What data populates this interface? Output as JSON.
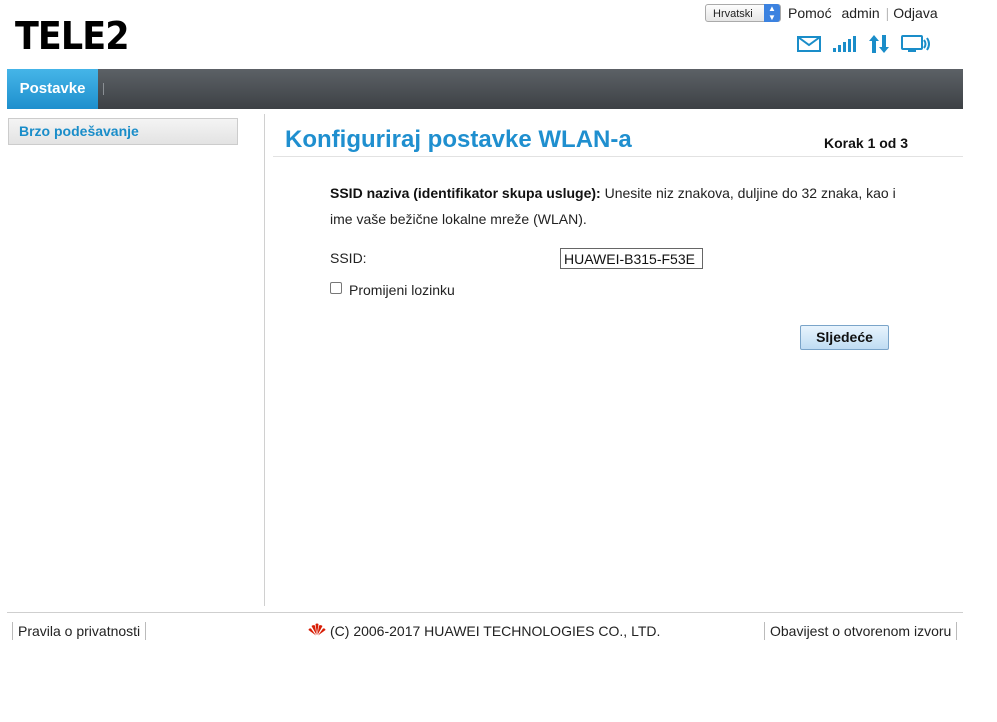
{
  "header": {
    "logo_text": "TELE2",
    "language": "Hrvatski",
    "help": "Pomoć",
    "user": "admin",
    "logout": "Odjava",
    "icons": [
      "mail-icon",
      "signal-icon",
      "data-transfer-icon",
      "monitor-icon"
    ],
    "icon_color": "#1a8dc9"
  },
  "nav": {
    "active_tab": "Postavke"
  },
  "sidebar": {
    "items": [
      {
        "label": "Brzo podešavanje"
      }
    ]
  },
  "main": {
    "title": "Konfiguriraj postavke WLAN-a",
    "step": "Korak 1 od 3",
    "desc_bold": "SSID naziva (identifikator skupa usluge):",
    "desc_text": " Unesite niz znakova, duljine do 32 znaka, kao i ime vaše bežične lokalne mreže (WLAN).",
    "ssid_label": "SSID:",
    "ssid_value": "HUAWEI-B315-F53E",
    "change_password_label": "Promijeni lozinku",
    "next_button": "Sljedeće"
  },
  "footer": {
    "privacy": "Pravila o privatnosti",
    "copyright": "(C) 2006-2017 HUAWEI TECHNOLOGIES CO., LTD.",
    "open_source": "Obavijest o otvorenom izvoru"
  },
  "colors": {
    "accent": "#1f8fcf",
    "tab": "#2aa3dd",
    "navbar": "#4a4e52"
  }
}
